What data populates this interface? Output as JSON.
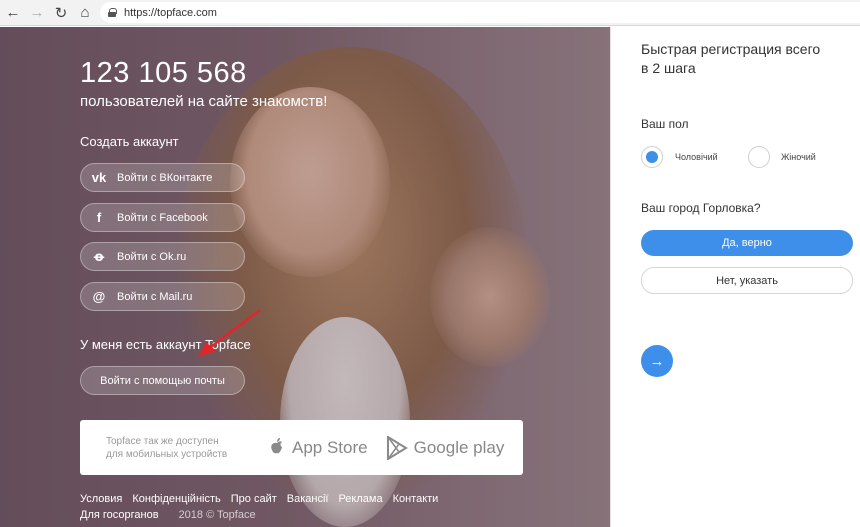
{
  "browser": {
    "url": "https://topface.com",
    "icons": [
      "back-arrow-icon",
      "forward-arrow-icon",
      "reload-icon",
      "home-icon",
      "lock-icon"
    ]
  },
  "hero": {
    "user_count": "123 105 568",
    "user_count_caption": "пользователей на сайте знакомств!",
    "create_account_label": "Создать аккаунт",
    "social_buttons": [
      {
        "label": "Войти с ВКонтакте",
        "icon": "vk-icon"
      },
      {
        "label": "Войти с Facebook",
        "icon": "facebook-icon"
      },
      {
        "label": "Войти с Ok.ru",
        "icon": "odnoklassniki-icon"
      },
      {
        "label": "Войти с Mail.ru",
        "icon": "mailru-icon"
      }
    ],
    "have_account_label": "У меня есть аккаунт Topface",
    "email_login_label": "Войти с помощью почты"
  },
  "stores": {
    "text_line1": "Topface так же доступен",
    "text_line2": "для мобильных устройств",
    "app_store": "App Store",
    "google_play": "Google play"
  },
  "footer": {
    "links": [
      "Условия",
      "Конфіденційність",
      "Про сайт",
      "Вакансії",
      "Реклама",
      "Контакти"
    ],
    "gov_link": "Для госорганов",
    "copyright": "2018 © Topface"
  },
  "panel": {
    "title": "Быстрая регистрация всего в 2 шага",
    "gender_label": "Ваш пол",
    "gender_options": [
      {
        "label": "Чоловічий",
        "checked": true
      },
      {
        "label": "Жіночий",
        "checked": false
      }
    ],
    "city_question": "Ваш город Горловка?",
    "yes_button": "Да, верно",
    "no_button": "Нет, указать",
    "next_button": "→"
  },
  "colors": {
    "accent": "#3d8fea",
    "annotation_arrow": "#e0262a"
  }
}
